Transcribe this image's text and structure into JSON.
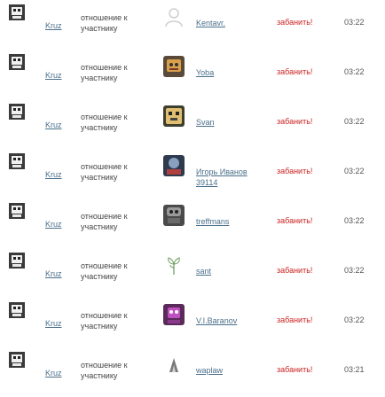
{
  "colors": {
    "link": "#4a6f8a",
    "action": "#cc2222",
    "text": "#444444",
    "time": "#555555"
  },
  "rows": [
    {
      "actor": "Kruz",
      "relation": "отношение к участнику",
      "target_name": "Kentavr.",
      "target_avatar": "default-user-icon",
      "action": "забанить!",
      "time": "03:22"
    },
    {
      "actor": "Kruz",
      "relation": "отношение к участнику",
      "target_name": "Yoba",
      "target_avatar": "user-avatar",
      "action": "забанить!",
      "time": "03:22"
    },
    {
      "actor": "Kruz",
      "relation": "отношение к участнику",
      "target_name": "Svan",
      "target_avatar": "user-avatar",
      "action": "забанить!",
      "time": "03:22"
    },
    {
      "actor": "Kruz",
      "relation": "отношение к участнику",
      "target_name": "Игорь Иванов 39114",
      "target_avatar": "user-avatar",
      "action": "забанить!",
      "time": "03:22"
    },
    {
      "actor": "Kruz",
      "relation": "отношение к участнику",
      "target_name": "treffmans",
      "target_avatar": "user-avatar",
      "action": "забанить!",
      "time": "03:22"
    },
    {
      "actor": "Kruz",
      "relation": "отношение к участнику",
      "target_name": "sant",
      "target_avatar": "plant-icon",
      "action": "забанить!",
      "time": "03:22"
    },
    {
      "actor": "Kruz",
      "relation": "отношение к участнику",
      "target_name": "V.I.Baranov",
      "target_avatar": "user-avatar",
      "action": "забанить!",
      "time": "03:22"
    },
    {
      "actor": "Kruz",
      "relation": "отношение к участнику",
      "target_name": "waplaw",
      "target_avatar": "user-avatar",
      "action": "забанить!",
      "time": "03:21"
    }
  ]
}
